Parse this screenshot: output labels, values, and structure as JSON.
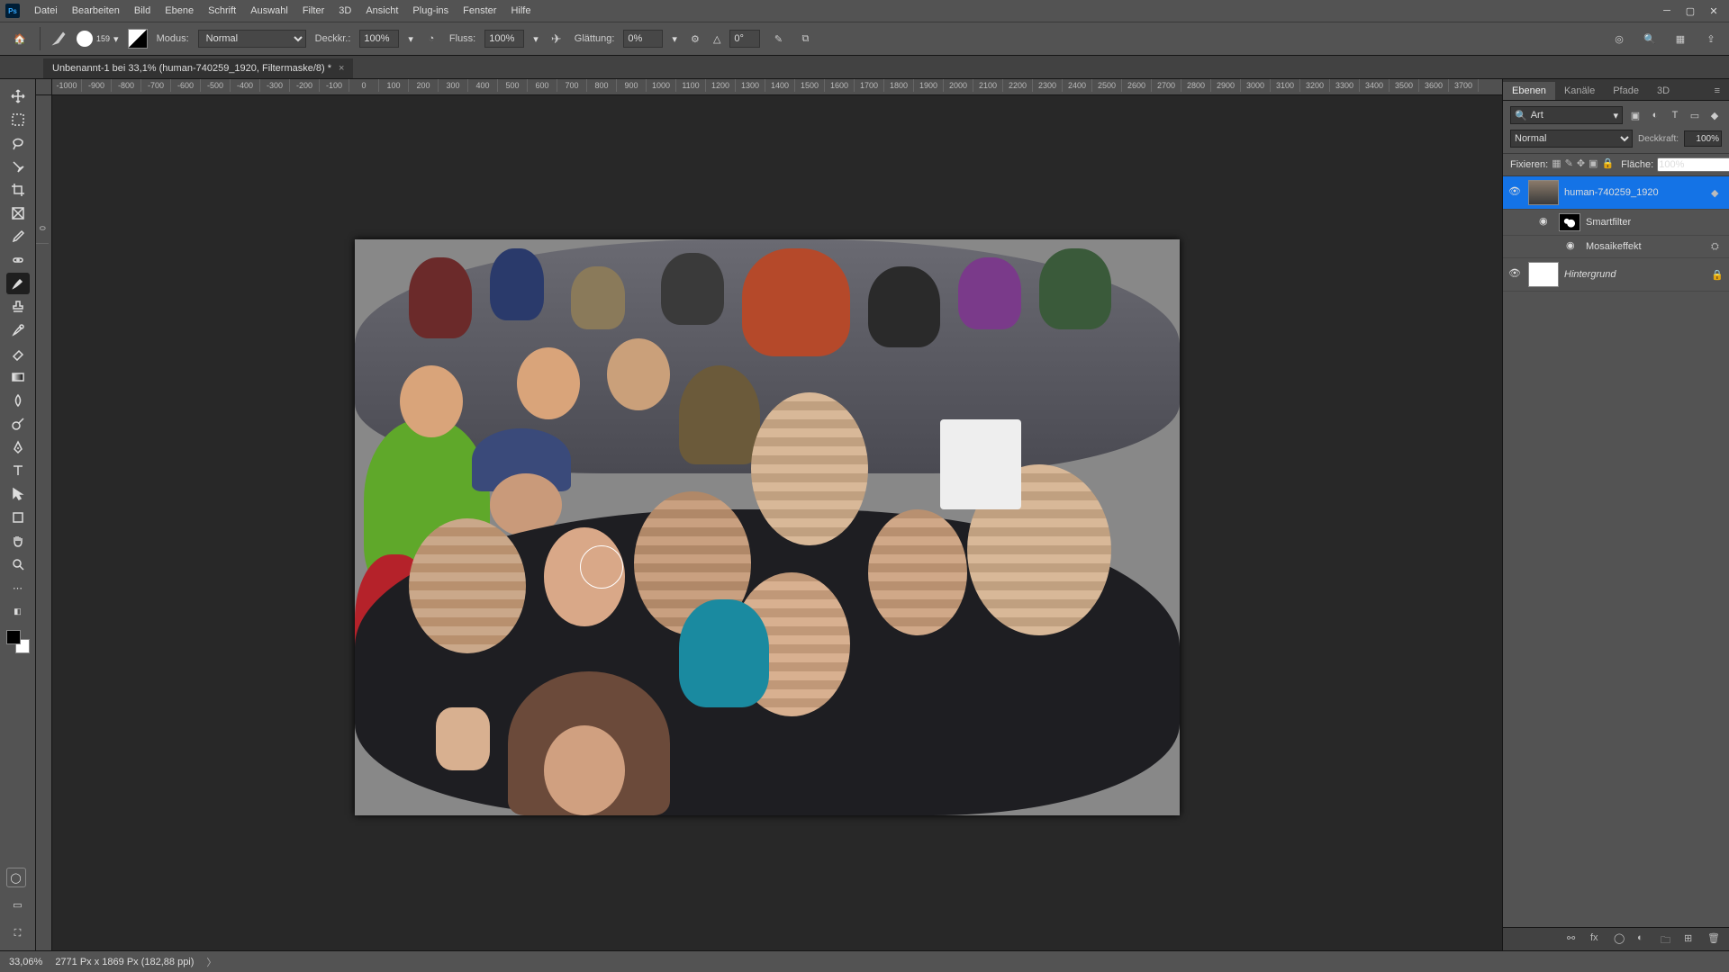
{
  "app": {
    "icon": "Ps"
  },
  "menu": [
    "Datei",
    "Bearbeiten",
    "Bild",
    "Ebene",
    "Schrift",
    "Auswahl",
    "Filter",
    "3D",
    "Ansicht",
    "Plug-ins",
    "Fenster",
    "Hilfe"
  ],
  "options": {
    "brush_size": "159",
    "modus_label": "Modus:",
    "modus_value": "Normal",
    "deckkr_label": "Deckkr.:",
    "deckkr_value": "100%",
    "fluss_label": "Fluss:",
    "fluss_value": "100%",
    "glattung_label": "Glättung:",
    "glattung_value": "0%",
    "angle_icon": "△",
    "angle_value": "0°"
  },
  "tab": {
    "title": "Unbenannt-1 bei 33,1% (human-740259_1920, Filtermaske/8) *"
  },
  "ruler_h": [
    "-1000",
    "-900",
    "-800",
    "-700",
    "-600",
    "-500",
    "-400",
    "-300",
    "-200",
    "-100",
    "0",
    "100",
    "200",
    "300",
    "400",
    "500",
    "600",
    "700",
    "800",
    "900",
    "1000",
    "1100",
    "1200",
    "1300",
    "1400",
    "1500",
    "1600",
    "1700",
    "1800",
    "1900",
    "2000",
    "2100",
    "2200",
    "2300",
    "2400",
    "2500",
    "2600",
    "2700",
    "2800",
    "2900",
    "3000",
    "3100",
    "3200",
    "3300",
    "3400",
    "3500",
    "3600",
    "3700"
  ],
  "ruler_v": [
    "",
    "",
    "",
    "",
    "0",
    "",
    "",
    "",
    "",
    "",
    "",
    "",
    "",
    "",
    "",
    "",
    "",
    "",
    "",
    "",
    "",
    "",
    "",
    "",
    "",
    "",
    "",
    "",
    ""
  ],
  "panels": {
    "tabs": [
      "Ebenen",
      "Kanäle",
      "Pfade",
      "3D"
    ],
    "search_placeholder": "Art",
    "blend_label": "Normal",
    "opacity_label": "Deckkraft:",
    "opacity_value": "100%",
    "lock_label": "Fixieren:",
    "fill_label": "Fläche:",
    "fill_value": "100%"
  },
  "layers": [
    {
      "name": "human-740259_1920",
      "type": "smart",
      "selected": true
    },
    {
      "name": "Smartfilter",
      "type": "filtergroup"
    },
    {
      "name": "Mosaikeffekt",
      "type": "filter"
    },
    {
      "name": "Hintergrund",
      "type": "bg"
    }
  ],
  "status": {
    "zoom": "33,06%",
    "docinfo": "2771 Px x 1869 Px (182,88 ppi)"
  },
  "colors": {
    "ui": "#535353",
    "canvas": "#282828",
    "accent": "#1473e6"
  }
}
